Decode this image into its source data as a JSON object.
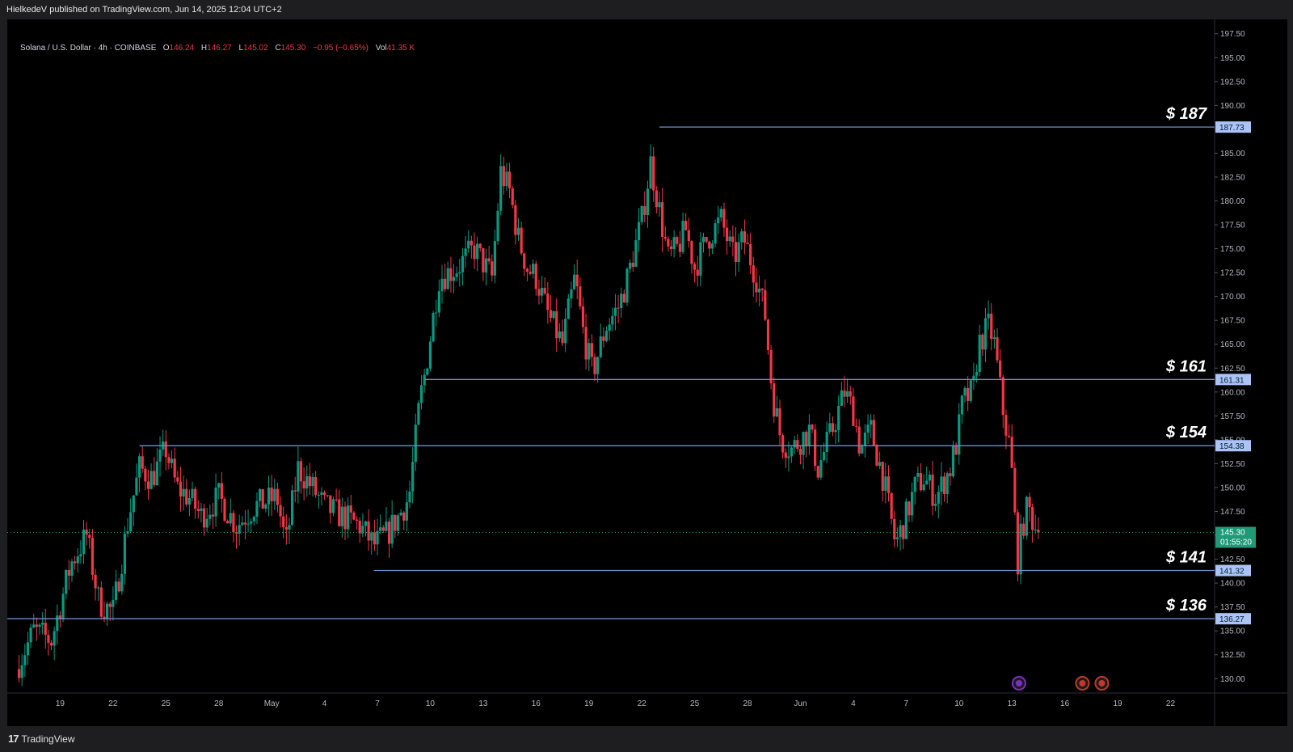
{
  "header": {
    "text": "HielkedeV published on TradingView.com, Jun 14, 2025 12:04 UTC+2"
  },
  "legend": {
    "symbol": "Solana / U.S. Dollar · 4h · COINBASE",
    "o_label": "O",
    "o": "146.24",
    "h_label": "H",
    "h": "146.27",
    "l_label": "L",
    "l": "145.02",
    "c_label": "C",
    "c": "145.30",
    "change": "−0.95 (−0.65%)",
    "vol_label": "Vol",
    "vol": "41.35 K"
  },
  "footer": {
    "brand": "TradingView",
    "brand_mark": "17"
  },
  "colors": {
    "up": "#089981",
    "down": "#f23645",
    "level": "#6f8fcc",
    "badge": "#a9c4f5",
    "last_price": "#1e9a78"
  },
  "icons": [
    "lightning-event-icon",
    "us-flag-event-icon",
    "us-flag-event-icon"
  ],
  "chart_data": {
    "type": "candlestick",
    "ylim": [
      128.5,
      199
    ],
    "y_ticks": [
      "130.00",
      "132.50",
      "135.00",
      "137.50",
      "140.00",
      "142.50",
      "145.00",
      "147.50",
      "150.00",
      "152.50",
      "155.00",
      "157.50",
      "160.00",
      "162.50",
      "165.00",
      "167.50",
      "170.00",
      "172.50",
      "175.00",
      "177.50",
      "180.00",
      "182.50",
      "185.00",
      "187.50",
      "190.00",
      "192.50",
      "195.00",
      "197.50"
    ],
    "x_ticks": [
      {
        "label": "19",
        "day": 19
      },
      {
        "label": "22",
        "day": 22
      },
      {
        "label": "25",
        "day": 25
      },
      {
        "label": "28",
        "day": 28
      },
      {
        "label": "May",
        "day": 31
      },
      {
        "label": "4",
        "day": 34
      },
      {
        "label": "7",
        "day": 37
      },
      {
        "label": "10",
        "day": 40
      },
      {
        "label": "13",
        "day": 43
      },
      {
        "label": "16",
        "day": 46
      },
      {
        "label": "19",
        "day": 49
      },
      {
        "label": "22",
        "day": 52
      },
      {
        "label": "25",
        "day": 55
      },
      {
        "label": "28",
        "day": 58
      },
      {
        "label": "Jun",
        "day": 61
      },
      {
        "label": "4",
        "day": 64
      },
      {
        "label": "7",
        "day": 67
      },
      {
        "label": "10",
        "day": 70
      },
      {
        "label": "13",
        "day": 73
      },
      {
        "label": "16",
        "day": 76
      },
      {
        "label": "19",
        "day": 79
      },
      {
        "label": "22",
        "day": 82
      }
    ],
    "close_path": [
      [
        16.5,
        131
      ],
      [
        17.5,
        135
      ],
      [
        18.5,
        134
      ],
      [
        19.6,
        142
      ],
      [
        20.5,
        145
      ],
      [
        21.2,
        138
      ],
      [
        22,
        137
      ],
      [
        22.9,
        147
      ],
      [
        23.5,
        152
      ],
      [
        24.2,
        151
      ],
      [
        25,
        154
      ],
      [
        25.6,
        150
      ],
      [
        26.3,
        149
      ],
      [
        27,
        147
      ],
      [
        28,
        149
      ],
      [
        29,
        146
      ],
      [
        30,
        148
      ],
      [
        31.3,
        149
      ],
      [
        31.8,
        144
      ],
      [
        32.5,
        152
      ],
      [
        33.3,
        150
      ],
      [
        34,
        148
      ],
      [
        35,
        147
      ],
      [
        36,
        146
      ],
      [
        36.8,
        144
      ],
      [
        37.5,
        145
      ],
      [
        38.2,
        147
      ],
      [
        38.8,
        149
      ],
      [
        39.4,
        159
      ],
      [
        39.7,
        162
      ],
      [
        40.5,
        172
      ],
      [
        41.5,
        173
      ],
      [
        42.5,
        175
      ],
      [
        43.5,
        172
      ],
      [
        44,
        183
      ],
      [
        44.5,
        181
      ],
      [
        45,
        176
      ],
      [
        45.5,
        173
      ],
      [
        46,
        172
      ],
      [
        46.7,
        168
      ],
      [
        47.5,
        165
      ],
      [
        48.2,
        172
      ],
      [
        48.7,
        166
      ],
      [
        49.2,
        162
      ],
      [
        50,
        167
      ],
      [
        50.7,
        169
      ],
      [
        51.2,
        172
      ],
      [
        52,
        178
      ],
      [
        52.5,
        184
      ],
      [
        53,
        179
      ],
      [
        53.5,
        174
      ],
      [
        54,
        175
      ],
      [
        54.5,
        177
      ],
      [
        55,
        173
      ],
      [
        55.7,
        176
      ],
      [
        56.5,
        178
      ],
      [
        57.2,
        174
      ],
      [
        57.8,
        176
      ],
      [
        58.5,
        172
      ],
      [
        59,
        168
      ],
      [
        59.4,
        160
      ],
      [
        59.9,
        155
      ],
      [
        60.5,
        154
      ],
      [
        61.5,
        156
      ],
      [
        62,
        152
      ],
      [
        62.8,
        156
      ],
      [
        63.5,
        160
      ],
      [
        64,
        158
      ],
      [
        64.4,
        154
      ],
      [
        65,
        156
      ],
      [
        65.7,
        151
      ],
      [
        66.4,
        144
      ],
      [
        67,
        147
      ],
      [
        67.5,
        150
      ],
      [
        68,
        151
      ],
      [
        68.7,
        149
      ],
      [
        69.5,
        152
      ],
      [
        69.9,
        155
      ],
      [
        70.2,
        159
      ],
      [
        70.8,
        160
      ],
      [
        71.1,
        165
      ],
      [
        71.7,
        167
      ],
      [
        72,
        165
      ],
      [
        72.5,
        158
      ],
      [
        72.9,
        154
      ],
      [
        73.1,
        149
      ],
      [
        73.3,
        142
      ],
      [
        73.6,
        146
      ],
      [
        73.9,
        148
      ],
      [
        74.3,
        146
      ],
      [
        74.5,
        145.3
      ]
    ],
    "levels": [
      {
        "label": "$ 187",
        "price": 187.73,
        "badge": "187.73",
        "start_day": 53.0
      },
      {
        "label": "$ 161",
        "price": 161.31,
        "badge": "161.31",
        "start_day": 39.7
      },
      {
        "label": "$ 154",
        "price": 154.38,
        "badge": "154.38",
        "start_day": 23.5
      },
      {
        "label": "$ 141",
        "price": 141.32,
        "badge": "141.32",
        "start_day": 36.8
      },
      {
        "label": "$ 136",
        "price": 136.27,
        "badge": "136.27",
        "start_day": 16.0
      }
    ],
    "last_price": {
      "price": 145.3,
      "label": "145.30",
      "countdown": "01:55:20"
    },
    "axis_start_day": 16.0,
    "axis_end_day": 84.5
  }
}
